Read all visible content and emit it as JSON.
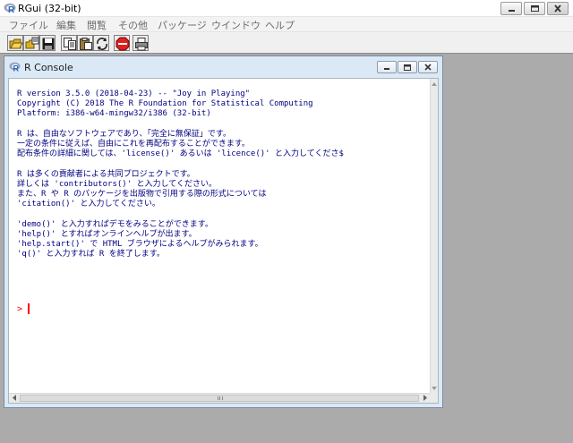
{
  "app": {
    "title": "RGui (32-bit)"
  },
  "menu": [
    {
      "label": "ファイル"
    },
    {
      "label": "編集"
    },
    {
      "label": "閲覧"
    },
    {
      "label": "その他"
    },
    {
      "label": "パッケージ"
    },
    {
      "label": "ウインドウ"
    },
    {
      "label": "ヘルプ"
    }
  ],
  "toolbar": [
    {
      "icon": "open-script-icon"
    },
    {
      "icon": "load-workspace-icon"
    },
    {
      "icon": "save-workspace-icon"
    },
    {
      "icon": "copy-icon"
    },
    {
      "icon": "paste-icon"
    },
    {
      "icon": "copy-paste-icon"
    },
    {
      "icon": "stop-icon"
    },
    {
      "icon": "print-icon"
    }
  ],
  "console": {
    "title": "R Console",
    "text": "R version 3.5.0 (2018-04-23) -- \"Joy in Playing\"\nCopyright (C) 2018 The R Foundation for Statistical Computing\nPlatform: i386-w64-mingw32/i386 (32-bit)\n\nR は、自由なソフトウェアであり、「完全に無保証」です。\n一定の条件に従えば、自由にこれを再配布することができます。\n配布条件の詳細に関しては、'license()' あるいは 'licence()' と入力してくださ$\n\nR は多くの貢献者による共同プロジェクトです。\n詳しくは 'contributors()' と入力してください。\nまた、R や R のパッケージを出版物で引用する際の形式については\n'citation()' と入力してください。\n\n'demo()' と入力すればデモをみることができます。\n'help()' とすればオンラインヘルプが出ます。\n'help.start()' で HTML ブラウザによるヘルプがみられます。\n'q()' と入力すれば R を終了します。",
    "prompt": ">",
    "colors": {
      "output": "#000080",
      "prompt": "#ff0000"
    }
  }
}
